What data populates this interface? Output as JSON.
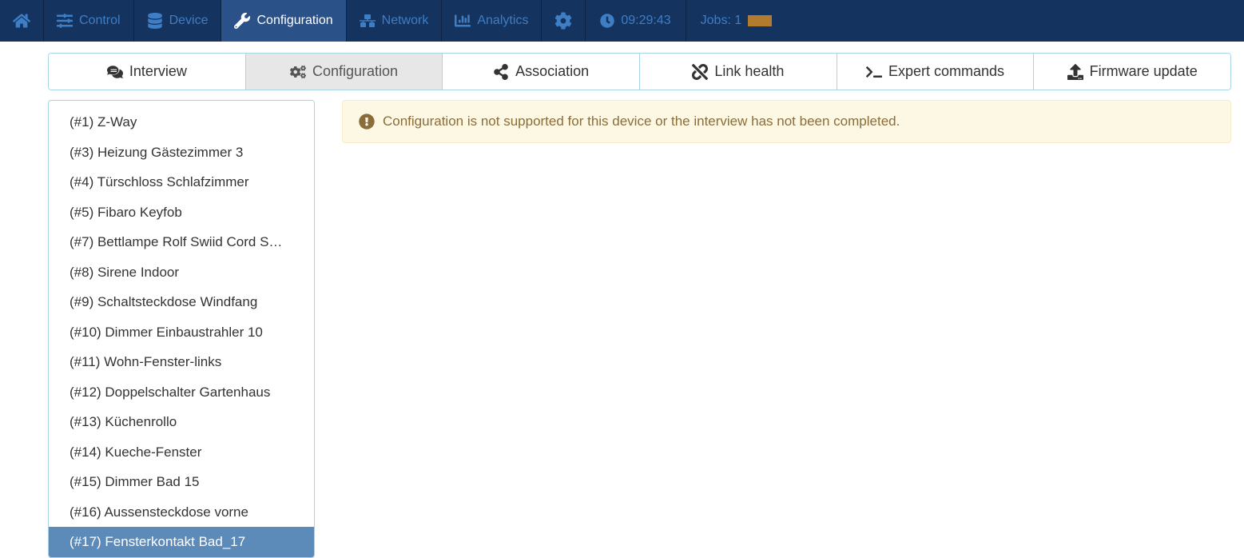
{
  "topnav": {
    "control": "Control",
    "device": "Device",
    "configuration": "Configuration",
    "network": "Network",
    "analytics": "Analytics",
    "time": "09:29:43",
    "jobs_label": "Jobs: 1"
  },
  "tabs": {
    "interview": "Interview",
    "configuration": "Configuration",
    "association": "Association",
    "link_health": "Link health",
    "expert_commands": "Expert commands",
    "firmware_update": "Firmware update"
  },
  "devices": [
    {
      "label": "(#1) Z-Way",
      "selected": false
    },
    {
      "label": "(#3) Heizung Gästezimmer 3",
      "selected": false
    },
    {
      "label": "(#4) Türschloss Schlafzimmer",
      "selected": false
    },
    {
      "label": "(#5) Fibaro Keyfob",
      "selected": false
    },
    {
      "label": "(#7) Bettlampe Rolf Swiid Cord S…",
      "selected": false
    },
    {
      "label": "(#8) Sirene Indoor",
      "selected": false
    },
    {
      "label": "(#9) Schaltsteckdose Windfang",
      "selected": false
    },
    {
      "label": "(#10) Dimmer Einbaustrahler 10",
      "selected": false
    },
    {
      "label": "(#11) Wohn-Fenster-links",
      "selected": false
    },
    {
      "label": "(#12) Doppelschalter Gartenhaus",
      "selected": false
    },
    {
      "label": "(#13) Küchenrollo",
      "selected": false
    },
    {
      "label": "(#14) Kueche-Fenster",
      "selected": false
    },
    {
      "label": "(#15) Dimmer Bad 15",
      "selected": false
    },
    {
      "label": "(#16) Aussensteckdose vorne",
      "selected": false
    },
    {
      "label": "(#17) Fensterkontakt Bad_17",
      "selected": true
    }
  ],
  "alert": {
    "message": "Configuration is not supported for this device or the interview has not been completed."
  }
}
